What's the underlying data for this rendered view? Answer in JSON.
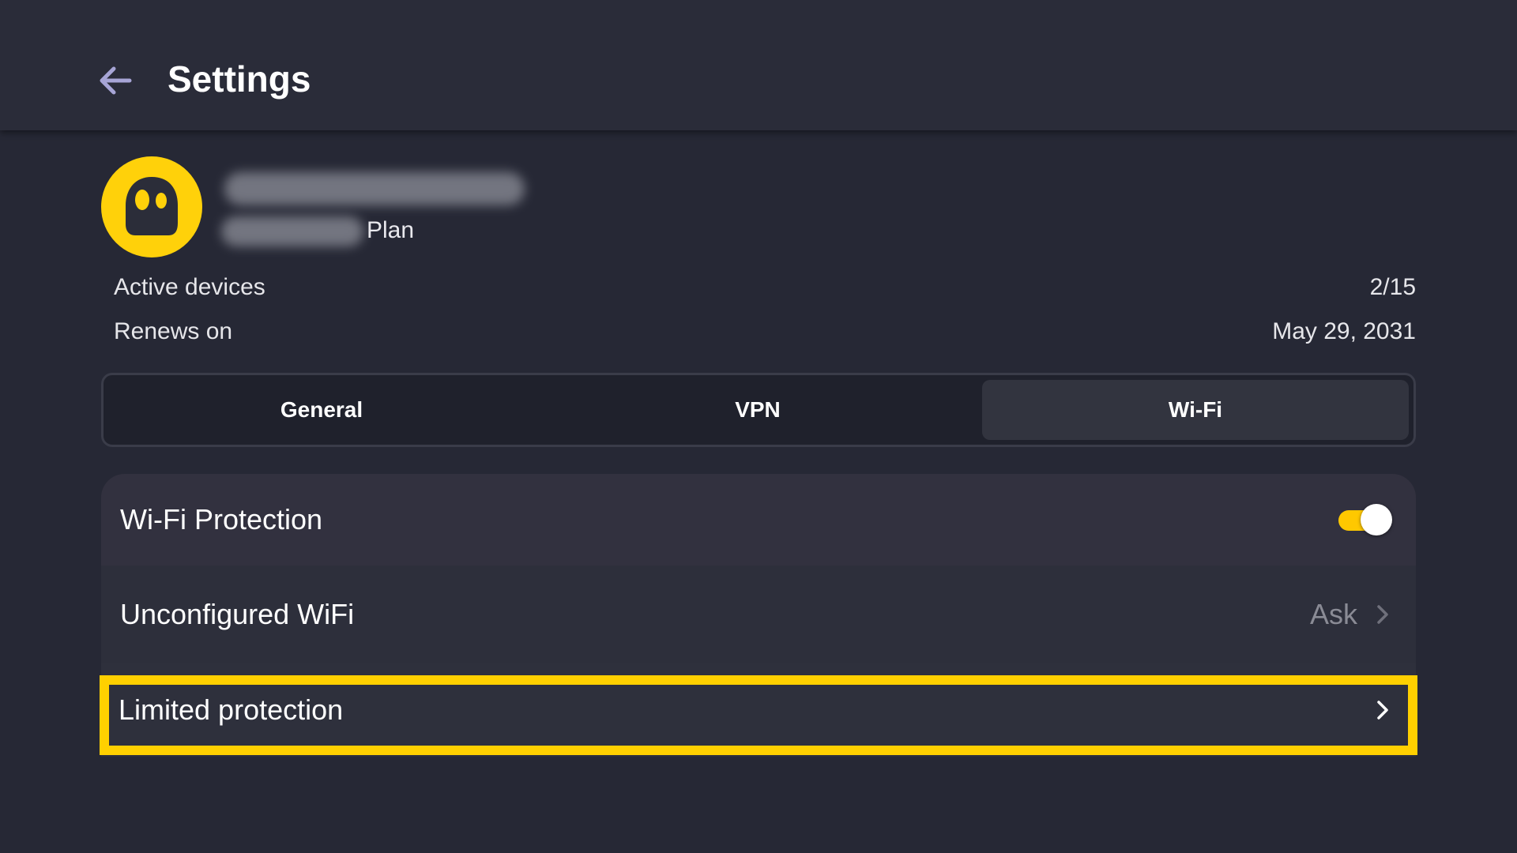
{
  "header": {
    "title": "Settings",
    "back_icon": "arrow-left-icon"
  },
  "account": {
    "avatar_icon": "ghost-logo-icon",
    "plan_suffix": "Plan",
    "active_devices_label": "Active devices",
    "active_devices_value": "2/15",
    "renews_label": "Renews on",
    "renews_value": "May 29, 2031"
  },
  "tabs": [
    {
      "label": "General",
      "active": false
    },
    {
      "label": "VPN",
      "active": false
    },
    {
      "label": "Wi-Fi",
      "active": true
    }
  ],
  "wifi": {
    "protection_label": "Wi-Fi Protection",
    "protection_enabled": true,
    "unconfigured_label": "Unconfigured WiFi",
    "unconfigured_value": "Ask",
    "limited_label": "Limited protection"
  },
  "colors": {
    "accent": "#ffd000",
    "background": "#262835",
    "header": "#2a2c39",
    "card": "#2e303c"
  }
}
